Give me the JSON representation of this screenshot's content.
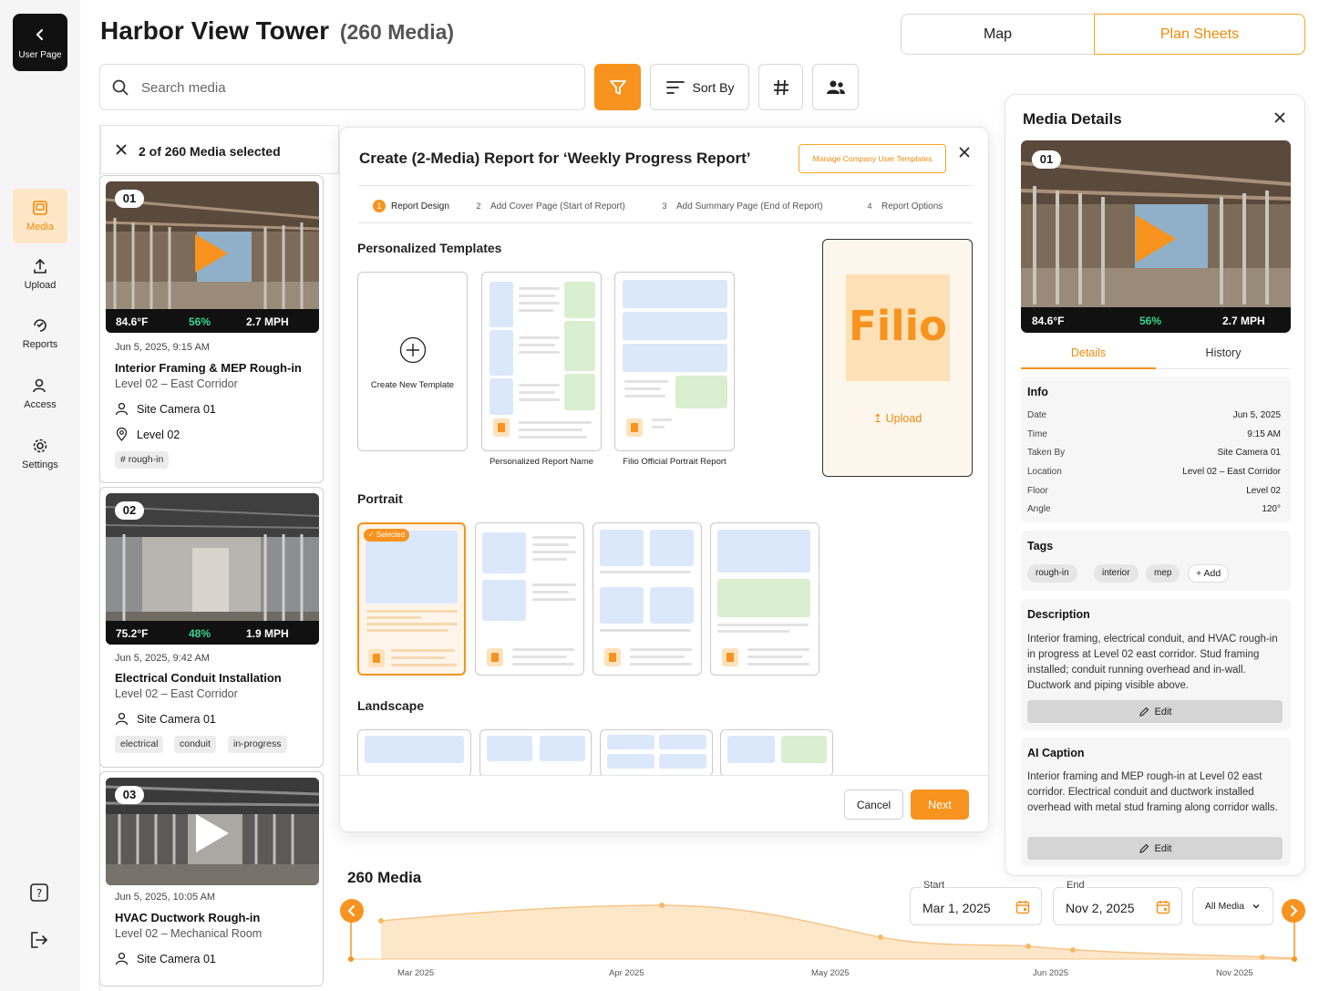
{
  "nav": {
    "back_label": "User Page",
    "items": [
      {
        "label": "Media",
        "icon": "media-icon",
        "active": true
      },
      {
        "label": "Upload",
        "icon": "upload-icon"
      },
      {
        "label": "Reports",
        "icon": "reports-icon"
      },
      {
        "label": "Access",
        "icon": "access-icon"
      },
      {
        "label": "Settings",
        "icon": "settings-icon"
      }
    ],
    "footer_icons": [
      "help-icon",
      "logout-icon"
    ]
  },
  "header": {
    "title": "Harbor View Tower",
    "count": "(260 Media)",
    "view_toggle": {
      "map": "Map",
      "plans": "Plan Sheets",
      "active": "Plan Sheets"
    }
  },
  "toolbar": {
    "search_placeholder": "Search media",
    "sort_label": "Sort By"
  },
  "selection": {
    "label": "2 of 260 Media selected"
  },
  "media": [
    {
      "num": "01",
      "temp": "84.6°F",
      "pct": "56%",
      "wind": "2.7 MPH",
      "date": "Jun 5, 2025, 9:15 AM",
      "title": "Interior Framing & MEP Rough-in",
      "location": "Level 02 – East Corridor",
      "camera": "Site Camera 01",
      "floor": "Level 02",
      "tags": [
        "# rough-in"
      ]
    },
    {
      "num": "02",
      "temp": "75.2°F",
      "pct": "48%",
      "wind": "1.9 MPH",
      "date": "Jun 5, 2025, 9:42 AM",
      "title": "Electrical Conduit Installation",
      "location": "Level 02 – East Corridor",
      "camera": "Site Camera 01",
      "tags": [
        "electrical",
        "conduit",
        "in-progress"
      ]
    },
    {
      "num": "03",
      "date": "Jun 5, 2025, 10:05 AM",
      "title": "HVAC Ductwork Rough-in",
      "location": "Level 02 – Mechanical Room",
      "camera": "Site Camera 01"
    }
  ],
  "modal": {
    "title": "Create (2-Media) Report for ‘Weekly Progress Report’",
    "manage_label": "Manage Company User Templates",
    "steps": [
      {
        "n": "1",
        "label": "Report Design"
      },
      {
        "n": "2",
        "label": "Add Cover Page (Start of Report)"
      },
      {
        "n": "3",
        "label": "Add Summary Page (End of Report)"
      },
      {
        "n": "4",
        "label": "Report Options"
      }
    ],
    "sections": {
      "personalized": "Personalized Templates",
      "portrait": "Portrait",
      "landscape": "Landscape"
    },
    "create_label": "Create New Template",
    "templates": [
      "Personalized Report Name",
      "Filio Official Portrait Report"
    ],
    "logo_text": "Filio",
    "upload_label": "Upload",
    "selected_badge": "✓ Selected",
    "cancel": "Cancel",
    "next": "Next"
  },
  "details": {
    "title": "Media Details",
    "num": "01",
    "temp": "84.6°F",
    "pct": "56%",
    "wind": "2.7 MPH",
    "tabs": {
      "details": "Details",
      "history": "History"
    },
    "info_title": "Info",
    "info": [
      {
        "k": "Date",
        "v": "Jun 5, 2025"
      },
      {
        "k": "Time",
        "v": "9:15 AM"
      },
      {
        "k": "Taken By",
        "v": "Site Camera 01"
      },
      {
        "k": "Location",
        "v": "Level 02 – East Corridor"
      },
      {
        "k": "Floor",
        "v": "Level 02"
      },
      {
        "k": "Angle",
        "v": "120°"
      }
    ],
    "tags_title": "Tags",
    "tags": [
      "rough-in",
      "interior",
      "mep"
    ],
    "add_label": "Add",
    "desc_title": "Description",
    "description": "Interior framing, electrical conduit, and HVAC rough-in in progress at Level 02 east corridor. Stud framing installed; conduit running overhead and in-wall. Ductwork and piping visible above.",
    "edit": "Edit",
    "ai_title": "AI Caption",
    "ai_caption": "Interior framing and MEP rough-in at Level 02 east corridor. Electrical conduit and ductwork installed overhead with metal stud framing along corridor walls."
  },
  "timeline": {
    "title": "260 Media",
    "start_label": "Start",
    "start": "Mar 1, 2025",
    "end_label": "End",
    "end": "Nov 2, 2025",
    "filter": "All Media",
    "ticks": [
      "Mar 2025",
      "Apr 2025",
      "May 2025",
      "Jun 2025",
      "Nov 2025"
    ]
  },
  "colors": {
    "accent": "#f7931e",
    "accent_text": "#f08a0c",
    "green": "#37d394"
  }
}
